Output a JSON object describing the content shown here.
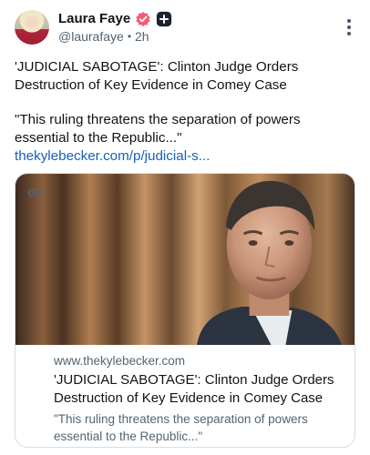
{
  "author": {
    "display_name": "Laura Faye",
    "handle": "@laurafaye",
    "separator": "•",
    "time": "2h",
    "avatar_icon": "profile-photo-avatar",
    "badge_icons": [
      "verified-check-badge-icon",
      "add-plus-badge-icon"
    ],
    "colors": {
      "verified_badge": "#f45b74",
      "plus_badge": "#1b2230"
    }
  },
  "post": {
    "headline": "'JUDICIAL SABOTAGE': Clinton Judge Orders Destruction of Key Evidence in Comey Case",
    "quote": "\"This ruling threatens the separation of powers essential to the Republic...\"",
    "link_text": "thekylebecker.com/p/judicial-s...",
    "colors": {
      "link": "#1a5fb4"
    }
  },
  "card": {
    "image_icon": "article-photo-man-portrait",
    "domain": "www.thekylebecker.com",
    "title": "'JUDICIAL SABOTAGE': Clinton Judge Orders Destruction of Key Evidence in Comey Case",
    "description": "\"This ruling threatens the separation of powers essential to the Republic...\"",
    "link_icon": "link-chain-icon"
  },
  "menu_icon": "more-options-vertical-icon"
}
